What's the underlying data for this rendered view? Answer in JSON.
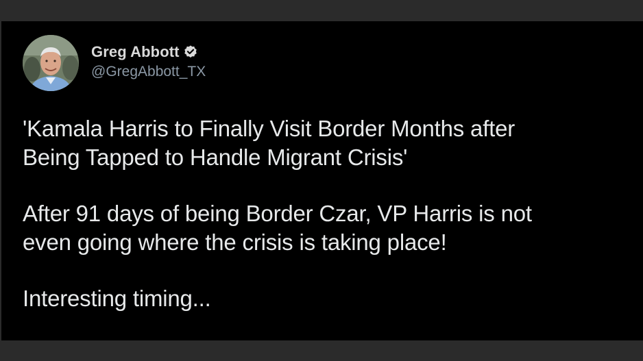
{
  "tweet": {
    "author": {
      "display_name": "Greg Abbott",
      "handle": "@GregAbbott_TX",
      "verified_icon": "verified-badge-icon",
      "avatar": "profile-photo"
    },
    "paragraphs": [
      "'Kamala Harris to Finally Visit Border Months after\nBeing Tapped to Handle Migrant Crisis'",
      "After 91 days of being Border Czar, VP Harris is not\neven going where the crisis is taking place!",
      "Interesting timing..."
    ]
  },
  "colors": {
    "background": "#000000",
    "frame": "#2b2b2b",
    "text": "#e7e9ea",
    "handle": "#8b98a5"
  }
}
